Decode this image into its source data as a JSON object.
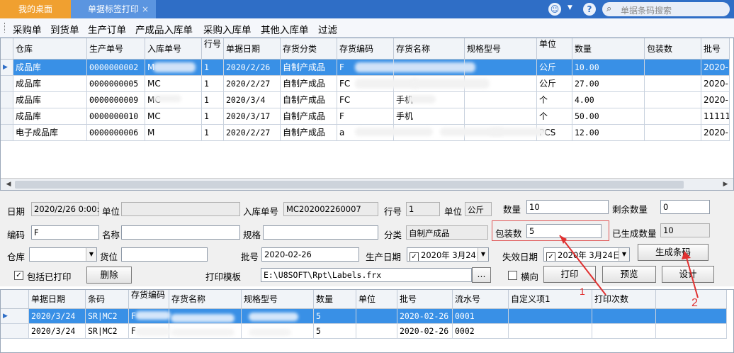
{
  "tabs": {
    "desk": "我的桌面",
    "print": "单据标签打印",
    "close": "×"
  },
  "header": {
    "search_placeholder": "单据条码搜索",
    "help": "?",
    "dropdown": "▼",
    "smile": "☺"
  },
  "toolbar": {
    "items": [
      "采购单",
      "到货单",
      "生产订单",
      "产成品入库单",
      "采购入库单",
      "其他入库单",
      "过滤"
    ]
  },
  "grid1": {
    "headers": [
      "仓库",
      "生产单号",
      "入库单号",
      "行号",
      "单据日期",
      "存货分类",
      "存货编码",
      "存货名称",
      "规格型号",
      "单位",
      "数量",
      "包装数",
      "批号"
    ],
    "rows": [
      [
        "成品库",
        "0000000002",
        "M",
        "1",
        "2020/2/26",
        "自制产成品",
        "F",
        "",
        "",
        "公斤",
        "10.00",
        "",
        "2020-"
      ],
      [
        "成品库",
        "0000000005",
        "MC",
        "1",
        "2020/2/27",
        "自制产成品",
        "FC",
        "",
        "",
        "公斤",
        "27.00",
        "",
        "2020-"
      ],
      [
        "成品库",
        "0000000009",
        "MC",
        "1",
        "2020/3/4",
        "自制产成品",
        "FC",
        "手机",
        "",
        "个",
        "4.00",
        "",
        "2020-"
      ],
      [
        "成品库",
        "0000000010",
        "MC",
        "1",
        "2020/3/17",
        "自制产成品",
        "F",
        "手机",
        "",
        "个",
        "50.00",
        "",
        "11111"
      ],
      [
        "电子成品库",
        "0000000006",
        "M",
        "1",
        "2020/2/27",
        "自制产成品",
        "a",
        "",
        "",
        "PCS",
        "12.00",
        "",
        "2020-"
      ]
    ]
  },
  "form": {
    "date_label": "日期",
    "date_value": "2020/2/26 0:00:0",
    "unit_label": "单位",
    "unit_value": "",
    "inbound_label": "入库单号",
    "inbound_value": "MC202002260007",
    "row_label": "行号",
    "row_value": "1",
    "uom_label": "单位",
    "uom_value": "公斤",
    "qty_label": "数量",
    "qty_value": "10",
    "remain_label": "剩余数量",
    "remain_value": "0",
    "code_label": "编码",
    "code_value": "F",
    "name_label": "名称",
    "name_value": "",
    "spec_label": "规格",
    "spec_value": "",
    "cat_label": "分类",
    "cat_value": "自制产成品",
    "pack_label": "包装数",
    "pack_value": "5",
    "generated_label": "已生成数量",
    "generated_value": "10",
    "wh_label": "仓库",
    "wh_value": "",
    "loc_label": "货位",
    "loc_value": "",
    "batch_label": "批号",
    "batch_value": "2020-02-26",
    "mfg_label": "生产日期",
    "mfg_value": "2020年 3月24日",
    "exp_label": "失效日期",
    "exp_value": "2020年 3月24日",
    "gen_button": "生成条码",
    "include_printed": "包括已打印",
    "delete_button": "删除",
    "template_label": "打印模板",
    "template_value": "E:\\U8SOFT\\Rpt\\Labels.frx",
    "browse_button": "...",
    "landscape_label": "横向",
    "print_button": "打印",
    "preview_button": "预览",
    "design_button": "设计",
    "annot1": "1",
    "annot2": "2"
  },
  "grid2": {
    "headers": [
      "单据日期",
      "条码",
      "存货编码",
      "存货名称",
      "规格型号",
      "数量",
      "单位",
      "批号",
      "流水号",
      "自定义项1",
      "打印次数"
    ],
    "rows": [
      [
        "2020/3/24",
        "SR|MC2",
        "F",
        "",
        "",
        "5",
        "",
        "2020-02-26",
        "0001",
        "",
        ""
      ],
      [
        "2020/3/24",
        "SR|MC2",
        "F",
        "",
        "",
        "5",
        "",
        "2020-02-26",
        "0002",
        "",
        ""
      ]
    ]
  },
  "colors": {
    "accent": "#2f6ec6",
    "selected": "#3990e6",
    "annotation": "#e03030"
  }
}
